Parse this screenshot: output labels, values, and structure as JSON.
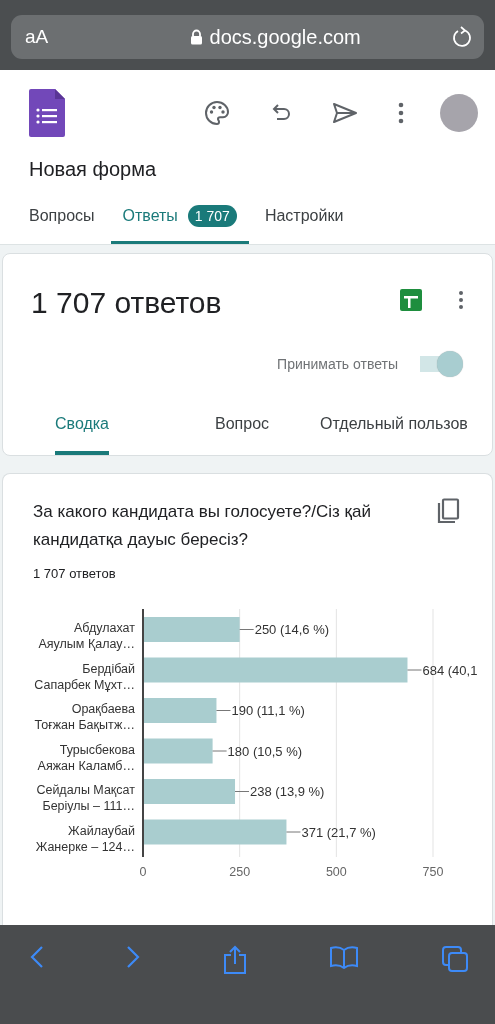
{
  "browser": {
    "text_size": "aA",
    "url": "docs.google.com"
  },
  "form": {
    "title": "Новая форма"
  },
  "tabs": [
    {
      "label": "Вопросы",
      "selected": false
    },
    {
      "label": "Ответы",
      "selected": true,
      "badge": "1 707"
    },
    {
      "label": "Настройки",
      "selected": false
    }
  ],
  "responses": {
    "count": "1 707 ответов",
    "accepting_label": "Принимать ответы",
    "accepting": true,
    "tabs": [
      {
        "label": "Сводка",
        "selected": true
      },
      {
        "label": "Вопрос",
        "selected": false
      },
      {
        "label": "Отдельный пользов",
        "selected": false
      }
    ]
  },
  "question": {
    "title": "За какого кандидата вы голосуете?/Сіз қай кандидатқа дауыс бересіз?",
    "count": "1 707 ответов",
    "chart_data": {
      "type": "bar",
      "orientation": "horizontal",
      "categories": [
        "Абдулахат Аяулым Қалау…",
        "Бердібай Сапарбек Мұхт…",
        "Орақбаева Тоғжан Бақытж…",
        "Турысбекова Аяжан Каламб…",
        "Сейдалы Мақсат Берiулы – 111…",
        "Жайлаубай Жанерке – 124…"
      ],
      "values": [
        250,
        684,
        190,
        180,
        238,
        371
      ],
      "value_labels": [
        "250 (14,6 %)",
        "684 (40,1",
        "190 (11,1 %)",
        "180 (10,5 %)",
        "238 (13,9 %)",
        "371 (21,7 %)"
      ],
      "xlim": [
        0,
        750
      ],
      "xticks": [
        0,
        250,
        500,
        750
      ]
    }
  }
}
